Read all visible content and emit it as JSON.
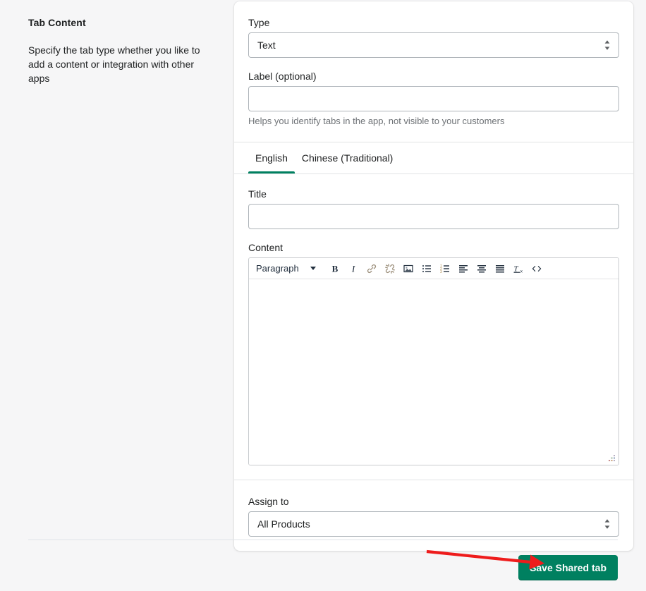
{
  "side_panel": {
    "title": "Tab Content",
    "description": "Specify the tab type whether you like to add a content or integration with other apps"
  },
  "form": {
    "type_field": {
      "label": "Type",
      "value": "Text",
      "options": [
        "Text"
      ]
    },
    "label_field": {
      "label": "Label (optional)",
      "value": "",
      "placeholder": "",
      "help_text": "Helps you identify tabs in the app, not visible to your customers"
    },
    "language_tabs": [
      {
        "label": "English",
        "active": true
      },
      {
        "label": "Chinese (Traditional)",
        "active": false
      }
    ],
    "title_field": {
      "label": "Title",
      "value": "",
      "placeholder": ""
    },
    "content_field": {
      "label": "Content",
      "value": "",
      "toolbar": {
        "block_format": "Paragraph",
        "buttons": [
          {
            "name": "bold-icon",
            "title": "Bold"
          },
          {
            "name": "italic-icon",
            "title": "Italic"
          },
          {
            "name": "link-icon",
            "title": "Insert/edit link"
          },
          {
            "name": "unlink-icon",
            "title": "Remove link"
          },
          {
            "name": "image-icon",
            "title": "Insert/edit image"
          },
          {
            "name": "bullet-list-icon",
            "title": "Bullet list"
          },
          {
            "name": "numbered-list-icon",
            "title": "Numbered list"
          },
          {
            "name": "align-left-icon",
            "title": "Align left"
          },
          {
            "name": "align-center-icon",
            "title": "Align center"
          },
          {
            "name": "align-justify-icon",
            "title": "Justify"
          },
          {
            "name": "clear-formatting-icon",
            "title": "Clear formatting"
          },
          {
            "name": "source-code-icon",
            "title": "Source code"
          }
        ]
      }
    },
    "assign_field": {
      "label": "Assign to",
      "value": "All Products",
      "options": [
        "All Products"
      ]
    }
  },
  "footer": {
    "save_label": "Save Shared tab"
  },
  "colors": {
    "accent_green": "#008060",
    "annotation_red": "#ee1c1c",
    "page_background": "#f6f6f7",
    "card_background": "#ffffff",
    "border": "#aeb4b9",
    "divider": "#e1e3e5",
    "help_text": "#6d7175"
  }
}
